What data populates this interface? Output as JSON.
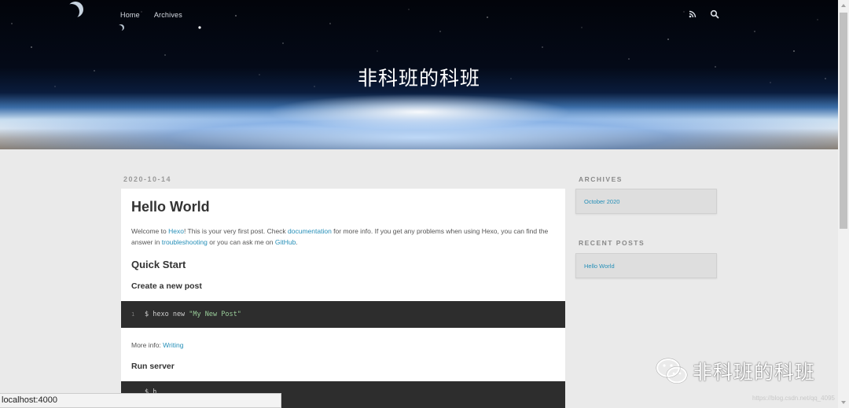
{
  "header": {
    "nav": [
      {
        "label": "Home"
      },
      {
        "label": "Archives"
      }
    ],
    "icons": [
      "rss-icon",
      "search-icon"
    ],
    "site_title": "非科班的科班"
  },
  "post": {
    "date": "2020-10-14",
    "title": "Hello World",
    "intro": {
      "t1": "Welcome to ",
      "link1": "Hexo",
      "t2": "! This is your very first post. Check ",
      "link2": "documentation",
      "t3": " for more info. If you get any problems when using Hexo, you can find the answer in ",
      "link3": "troubleshooting",
      "t4": " or you can ask me on ",
      "link4": "GitHub",
      "t5": "."
    },
    "h_quick_start": "Quick Start",
    "h_create_post": "Create a new post",
    "code1": {
      "line": "1",
      "cmd": "$ hexo new ",
      "arg": "\"My New Post\""
    },
    "more_info": {
      "text": "More info: ",
      "link": "Writing"
    },
    "h_run_server": "Run server",
    "code2": {
      "cmd": "$ h"
    }
  },
  "sidebar": {
    "archives_title": "ARCHIVES",
    "archives_item": "October 2020",
    "recent_title": "RECENT POSTS",
    "recent_item": "Hello World"
  },
  "statusbar": {
    "text": "localhost:4000"
  },
  "watermark": {
    "text": "非科班的科班",
    "url": "https://blog.csdn.net/qq_4095"
  },
  "colors": {
    "link": "#258fb8",
    "code_bg": "#2d2d2d",
    "string": "#99cc99"
  }
}
